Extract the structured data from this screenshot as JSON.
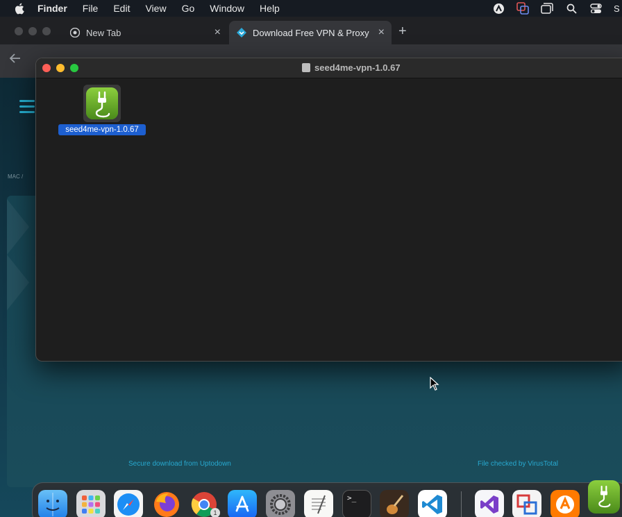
{
  "menubar": {
    "app_name": "Finder",
    "items": [
      "File",
      "Edit",
      "View",
      "Go",
      "Window",
      "Help"
    ],
    "right_icons": [
      "account-icon",
      "screen-share-icon",
      "window-icon",
      "search-icon",
      "control-center-icon"
    ],
    "right_text": "S"
  },
  "browser": {
    "tabs": [
      {
        "label": "New Tab",
        "icon": "chrome-icon"
      },
      {
        "label": "Download Free VPN & Proxy (",
        "icon": "uptodown-icon"
      }
    ],
    "new_tab_symbol": "+",
    "close_symbol": "×"
  },
  "page": {
    "breadcrumb": "MAC  /",
    "footer_left": "Secure download from Uptodown",
    "footer_right": "File checked by VirusTotal"
  },
  "finder": {
    "title": "seed4me-vpn-1.0.67",
    "item_label": "seed4me-vpn-1.0.67"
  },
  "dock": {
    "apps": [
      "Finder",
      "Launchpad",
      "Safari",
      "Firefox",
      "Chrome",
      "App Store",
      "System Settings",
      "TextEdit",
      "Terminal",
      "GarageBand",
      "Visual Studio Code",
      "Visual Studio",
      "Parallels",
      "Avast",
      "seed4me VPN"
    ],
    "chrome_badge": "1",
    "terminal_prompt": ">_"
  },
  "colors": {
    "selection": "#1d5fd0",
    "accent_link": "#28a9cf",
    "seed4me_green": "#6bb02d"
  }
}
